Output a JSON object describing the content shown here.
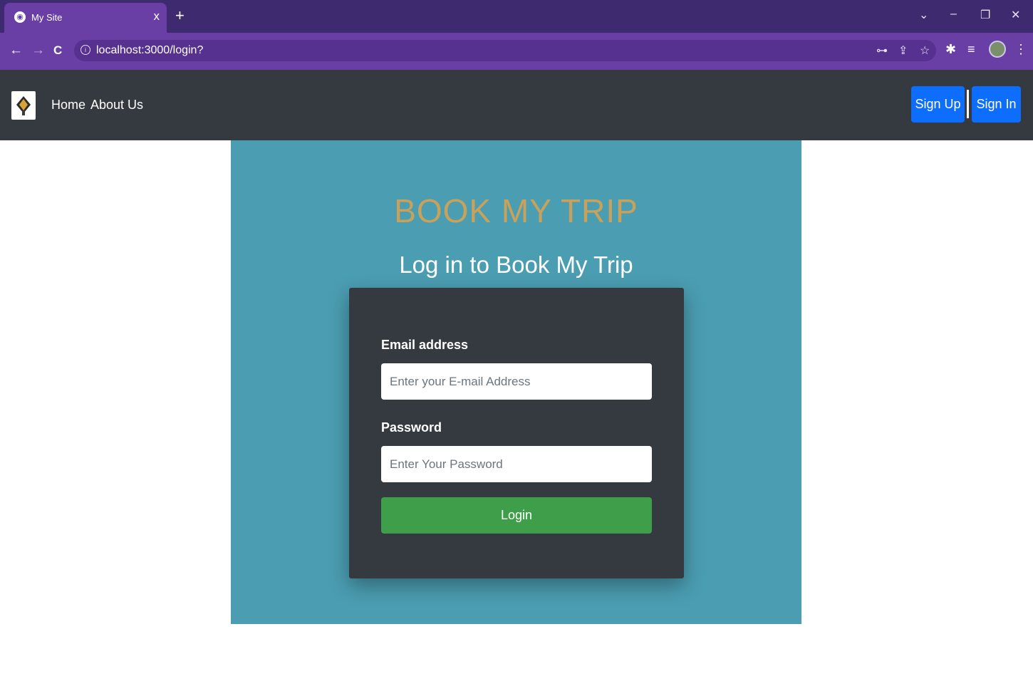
{
  "browser": {
    "tab_title": "My Site",
    "tab_close_glyph": "x",
    "new_tab_glyph": "+",
    "url": "localhost:3000/login?",
    "window_controls": {
      "dropdown": "⌄",
      "minimize": "–",
      "restore": "❐",
      "close": "✕"
    },
    "nav": {
      "back": "←",
      "forward": "→",
      "reload": "C"
    },
    "omnibox_icons": [
      "key-icon",
      "share-icon",
      "star-icon"
    ],
    "toolbar_icons": [
      "extensions-icon",
      "reading-list-icon",
      "profile-avatar",
      "menu-icon"
    ]
  },
  "navbar": {
    "home_label": "Home",
    "about_label": "About Us",
    "signup_label": "Sign Up",
    "signin_label": "Sign In",
    "button_color": "#0d6efd",
    "background": "#343a40"
  },
  "hero": {
    "brand": "BOOK MY TRIP",
    "subtitle": "Log in to Book My Trip",
    "brand_color": "#c8a15a",
    "background": "#4b9db2"
  },
  "form": {
    "email_label": "Email address",
    "email_placeholder": "Enter your E-mail Address",
    "email_value": "",
    "password_label": "Password",
    "password_placeholder": "Enter Your Password",
    "password_value": "",
    "login_label": "Login",
    "login_color": "#3e9e49"
  }
}
